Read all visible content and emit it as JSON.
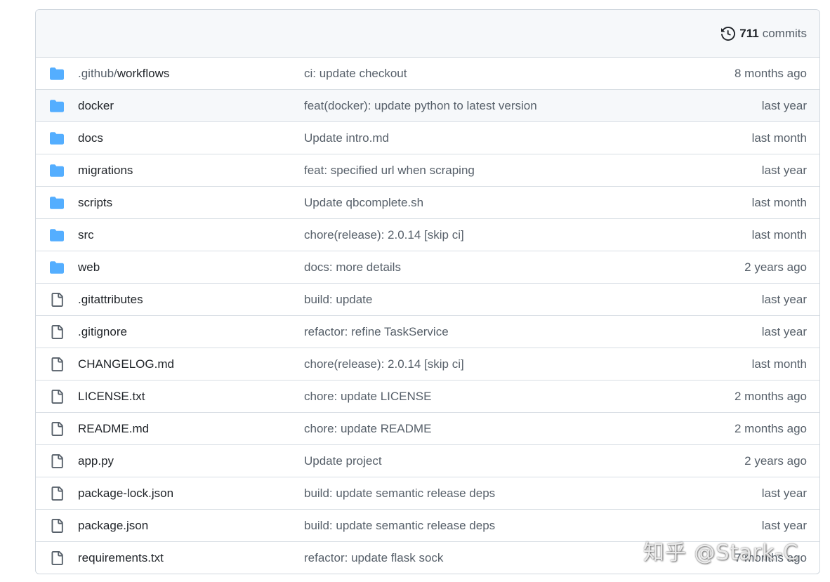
{
  "header": {
    "commit_count": "711",
    "commits_label": "commits",
    "icon": "history-icon"
  },
  "files": [
    {
      "type": "folder",
      "name_prefix": ".github/",
      "name": "workflows",
      "message": "ci: update checkout",
      "age": "8 months ago"
    },
    {
      "type": "folder",
      "name_prefix": "",
      "name": "docker",
      "message": "feat(docker): update python to latest version",
      "age": "last year"
    },
    {
      "type": "folder",
      "name_prefix": "",
      "name": "docs",
      "message": "Update intro.md",
      "age": "last month"
    },
    {
      "type": "folder",
      "name_prefix": "",
      "name": "migrations",
      "message": "feat: specified url when scraping",
      "age": "last year"
    },
    {
      "type": "folder",
      "name_prefix": "",
      "name": "scripts",
      "message": "Update qbcomplete.sh",
      "age": "last month"
    },
    {
      "type": "folder",
      "name_prefix": "",
      "name": "src",
      "message": "chore(release): 2.0.14 [skip ci]",
      "age": "last month"
    },
    {
      "type": "folder",
      "name_prefix": "",
      "name": "web",
      "message": "docs: more details",
      "age": "2 years ago"
    },
    {
      "type": "file",
      "name_prefix": "",
      "name": ".gitattributes",
      "message": "build: update",
      "age": "last year"
    },
    {
      "type": "file",
      "name_prefix": "",
      "name": ".gitignore",
      "message": "refactor: refine TaskService",
      "age": "last year"
    },
    {
      "type": "file",
      "name_prefix": "",
      "name": "CHANGELOG.md",
      "message": "chore(release): 2.0.14 [skip ci]",
      "age": "last month"
    },
    {
      "type": "file",
      "name_prefix": "",
      "name": "LICENSE.txt",
      "message": "chore: update LICENSE",
      "age": "2 months ago"
    },
    {
      "type": "file",
      "name_prefix": "",
      "name": "README.md",
      "message": "chore: update README",
      "age": "2 months ago"
    },
    {
      "type": "file",
      "name_prefix": "",
      "name": "app.py",
      "message": "Update project",
      "age": "2 years ago"
    },
    {
      "type": "file",
      "name_prefix": "",
      "name": "package-lock.json",
      "message": "build: update semantic release deps",
      "age": "last year"
    },
    {
      "type": "file",
      "name_prefix": "",
      "name": "package.json",
      "message": "build: update semantic release deps",
      "age": "last year"
    },
    {
      "type": "file",
      "name_prefix": "",
      "name": "requirements.txt",
      "message": "refactor: update flask sock",
      "age": "7 months ago"
    }
  ],
  "hover_row": 1,
  "colors": {
    "folder": "#54aeff",
    "file_icon": "#57606a",
    "header_bg": "#f6f8fa",
    "border": "#d0d7de"
  },
  "watermark": "知乎 @Stark-C"
}
